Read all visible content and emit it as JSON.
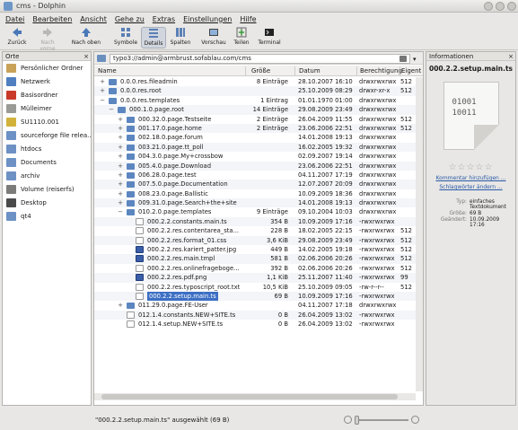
{
  "window": {
    "title": "cms - Dolphin"
  },
  "menu": [
    "Datei",
    "Bearbeiten",
    "Ansicht",
    "Gehe zu",
    "Extras",
    "Einstellungen",
    "Hilfe"
  ],
  "toolbar": {
    "back": "Zurück",
    "forward": "Nach vorne",
    "up": "Nach oben",
    "icons_view": "Symbole",
    "details_view": "Details",
    "columns_view": "Spalten",
    "preview": "Vorschau",
    "split": "Teilen",
    "terminal": "Terminal"
  },
  "places": {
    "title": "Orte",
    "close": "×",
    "items": [
      {
        "label": "Persönlicher Ordner",
        "color": "#c9a25a"
      },
      {
        "label": "Netzwerk",
        "color": "#4f7fbf"
      },
      {
        "label": "Basisordner",
        "color": "#c93a2a"
      },
      {
        "label": "Mülleimer",
        "color": "#9a9a96"
      },
      {
        "label": "SU1110.001",
        "color": "#d2b23a"
      },
      {
        "label": "sourceforge file relea...",
        "color": "#6d91c4"
      },
      {
        "label": "htdocs",
        "color": "#6d91c4"
      },
      {
        "label": "Documents",
        "color": "#6d91c4"
      },
      {
        "label": "archiv",
        "color": "#6d91c4"
      },
      {
        "label": "Volume (reiserfs)",
        "color": "#7c7c7a"
      },
      {
        "label": "Desktop",
        "color": "#4a4a4a"
      },
      {
        "label": "qt4",
        "color": "#6d91c4"
      }
    ]
  },
  "location": {
    "path": "typo3://admin@armbrust.sofablau.com/cms",
    "go": "▾"
  },
  "columns": {
    "name": "Name",
    "size": "Größe",
    "date": "Datum",
    "perms": "Berechtigung",
    "owner": "Eigent"
  },
  "rows": [
    {
      "exp": "+",
      "level": 0,
      "type": "folder",
      "name": "0.0.0.res.fileadmin",
      "size": "8 Einträge",
      "date": "28.10.2007 16:10",
      "perms": "drwxrwxrwx",
      "owner": "512"
    },
    {
      "exp": "+",
      "level": 0,
      "type": "folder",
      "name": "0.0.0.res.root",
      "size": "",
      "date": "25.10.2009 08:29",
      "perms": "drwxr-xr-x",
      "owner": "512"
    },
    {
      "exp": "−",
      "level": 0,
      "type": "folder",
      "name": "0.0.0.res.templates",
      "size": "1 Eintrag",
      "date": "01.01.1970 01:00",
      "perms": "drwxrwxrwx",
      "owner": ""
    },
    {
      "exp": "−",
      "level": 1,
      "type": "folder",
      "name": "000.1.0.page.root",
      "size": "14 Einträge",
      "date": "29.08.2009 23:49",
      "perms": "drwxrwxrwx",
      "owner": ""
    },
    {
      "exp": "+",
      "level": 2,
      "type": "folder",
      "name": "000.32.0.page.Testseite",
      "size": "2 Einträge",
      "date": "26.04.2009 11:55",
      "perms": "drwxrwxrwx",
      "owner": "512"
    },
    {
      "exp": "+",
      "level": 2,
      "type": "folder",
      "name": "001.17.0.page.home",
      "size": "2 Einträge",
      "date": "23.06.2006 22:51",
      "perms": "drwxrwxrwx",
      "owner": "512"
    },
    {
      "exp": "+",
      "level": 2,
      "type": "folder",
      "name": "002.18.0.page.forum",
      "size": "",
      "date": "14.01.2008 19:13",
      "perms": "drwxrwxrwx",
      "owner": ""
    },
    {
      "exp": "+",
      "level": 2,
      "type": "folder",
      "name": "003.21.0.page.tt_poll",
      "size": "",
      "date": "16.02.2005 19:32",
      "perms": "drwxrwxrwx",
      "owner": ""
    },
    {
      "exp": "+",
      "level": 2,
      "type": "folder",
      "name": "004.3.0.page.My+crossbow",
      "size": "",
      "date": "02.09.2007 19:14",
      "perms": "drwxrwxrwx",
      "owner": ""
    },
    {
      "exp": "+",
      "level": 2,
      "type": "folder",
      "name": "005.4.0.page.Download",
      "size": "",
      "date": "23.06.2006 22:51",
      "perms": "drwxrwxrwx",
      "owner": ""
    },
    {
      "exp": "+",
      "level": 2,
      "type": "folder",
      "name": "006.28.0.page.test",
      "size": "",
      "date": "04.11.2007 17:19",
      "perms": "drwxrwxrwx",
      "owner": ""
    },
    {
      "exp": "+",
      "level": 2,
      "type": "folder",
      "name": "007.5.0.page.Documentation",
      "size": "",
      "date": "12.07.2007 20:09",
      "perms": "drwxrwxrwx",
      "owner": ""
    },
    {
      "exp": "+",
      "level": 2,
      "type": "folder",
      "name": "008.23.0.page.Ballistic",
      "size": "",
      "date": "10.09.2009 18:36",
      "perms": "drwxrwxrwx",
      "owner": ""
    },
    {
      "exp": "+",
      "level": 2,
      "type": "folder",
      "name": "009.31.0.page.Search+the+site",
      "size": "",
      "date": "14.01.2008 19:13",
      "perms": "drwxrwxrwx",
      "owner": ""
    },
    {
      "exp": "−",
      "level": 2,
      "type": "folder",
      "name": "010.2.0.page.templates",
      "size": "9 Einträge",
      "date": "09.10.2004 10:03",
      "perms": "drwxrwxrwx",
      "owner": ""
    },
    {
      "exp": "",
      "level": 3,
      "type": "file",
      "name": "000.2.2.constants.main.ts",
      "size": "354 B",
      "date": "10.09.2009 17:16",
      "perms": "-rwxrwxrwx",
      "owner": ""
    },
    {
      "exp": "",
      "level": 3,
      "type": "file",
      "name": "000.2.2.res.contentarea_sta...",
      "size": "228 B",
      "date": "18.02.2005 22:15",
      "perms": "-rwxrwxrwx",
      "owner": "512"
    },
    {
      "exp": "",
      "level": 3,
      "type": "file",
      "name": "000.2.2.res.format_01.css",
      "size": "3,6 KiB",
      "date": "29.08.2009 23:49",
      "perms": "-rwxrwxrwx",
      "owner": "512"
    },
    {
      "exp": "",
      "level": 3,
      "type": "img",
      "name": "000.2.2.res.kariert_patter.jpg",
      "size": "449 B",
      "date": "14.02.2005 19:18",
      "perms": "-rwxrwxrwx",
      "owner": "512"
    },
    {
      "exp": "",
      "level": 3,
      "type": "img",
      "name": "000.2.2.res.main.tmpl",
      "size": "581 B",
      "date": "02.06.2006 20:26",
      "perms": "-rwxrwxrwx",
      "owner": "512"
    },
    {
      "exp": "",
      "level": 3,
      "type": "file",
      "name": "000.2.2.res.onlinefrageboge...",
      "size": "392 B",
      "date": "02.06.2006 20:26",
      "perms": "-rwxrwxrwx",
      "owner": "512"
    },
    {
      "exp": "",
      "level": 3,
      "type": "img",
      "name": "000.2.2.res.pdf.png",
      "size": "1,1 KiB",
      "date": "25.11.2007 11:40",
      "perms": "-rwxrwxrwx",
      "owner": "99"
    },
    {
      "exp": "",
      "level": 3,
      "type": "file",
      "name": "000.2.2.res.typoscript_root.txt",
      "size": "10,5 KiB",
      "date": "25.10.2009 09:05",
      "perms": "-rw-r--r--",
      "owner": "512"
    },
    {
      "exp": "",
      "level": 3,
      "type": "file",
      "name": "000.2.2.setup.main.ts",
      "size": "69 B",
      "date": "10.09.2009 17:16",
      "perms": "-rwxrwxrwx",
      "owner": "",
      "selected": true
    },
    {
      "exp": "+",
      "level": 2,
      "type": "folder",
      "name": "011.29.0.page.FE-User",
      "size": "",
      "date": "04.11.2007 17:18",
      "perms": "drwxrwxrwx",
      "owner": ""
    },
    {
      "exp": "",
      "level": 2,
      "type": "file",
      "name": "012.1.4.constants.NEW+SITE.ts",
      "size": "0 B",
      "date": "26.04.2009 13:02",
      "perms": "-rwxrwxrwx",
      "owner": ""
    },
    {
      "exp": "",
      "level": 2,
      "type": "file",
      "name": "012.1.4.setup.NEW+SITE.ts",
      "size": "0 B",
      "date": "26.04.2009 13:02",
      "perms": "-rwxrwxrwx",
      "owner": ""
    }
  ],
  "info": {
    "title": "Informationen",
    "close": "×",
    "filename": "000.2.2.setup.main.ts",
    "preview_line1": "01001",
    "preview_line2": "10011",
    "stars": "☆☆☆☆☆",
    "add_comment": "Kommentar hinzufügen ...",
    "tags": "Schlagwörter ändern ...",
    "meta": [
      {
        "k": "Typ:",
        "v": "einfaches Textdokument"
      },
      {
        "k": "Größe:",
        "v": "69 B"
      },
      {
        "k": "Geändert:",
        "v": "10.09.2009 17:16"
      }
    ]
  },
  "status": {
    "text": "\"000.2.2.setup.main.ts\" ausgewählt (69 B)"
  }
}
